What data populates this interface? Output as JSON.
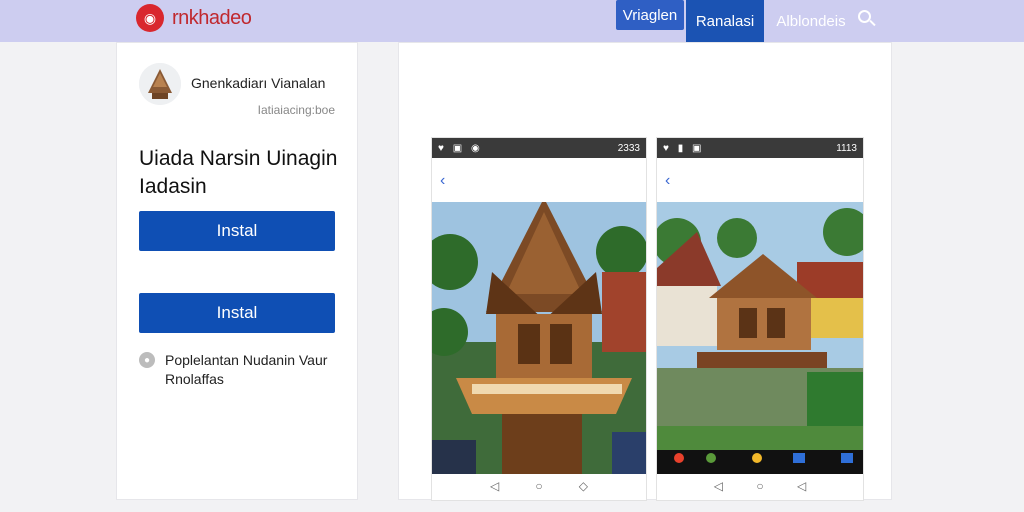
{
  "header": {
    "logo_text": "rnkhadeo",
    "nav": [
      "Vriaglen",
      "Ranalasi",
      "Alblondeis"
    ]
  },
  "app": {
    "developer": "Gnenkadiarı Vianalan",
    "subtitle": "Iatiaiacing:boe",
    "title": "Uiada Narsin Uinagin Iadasin",
    "install_label": "Instal",
    "install_label_2": "Instal",
    "note": "Poplelantan Nudanin Vaur Rnolaffas"
  },
  "screens": [
    {
      "status_left": "♥ ▣ ◉",
      "status_right": "2333"
    },
    {
      "status_left": "♥ ▮ ▣",
      "status_right": "1113"
    }
  ],
  "colors": {
    "accent": "#0f4fb4",
    "topbar": "#cdcdf0",
    "brand": "#d9272e"
  }
}
